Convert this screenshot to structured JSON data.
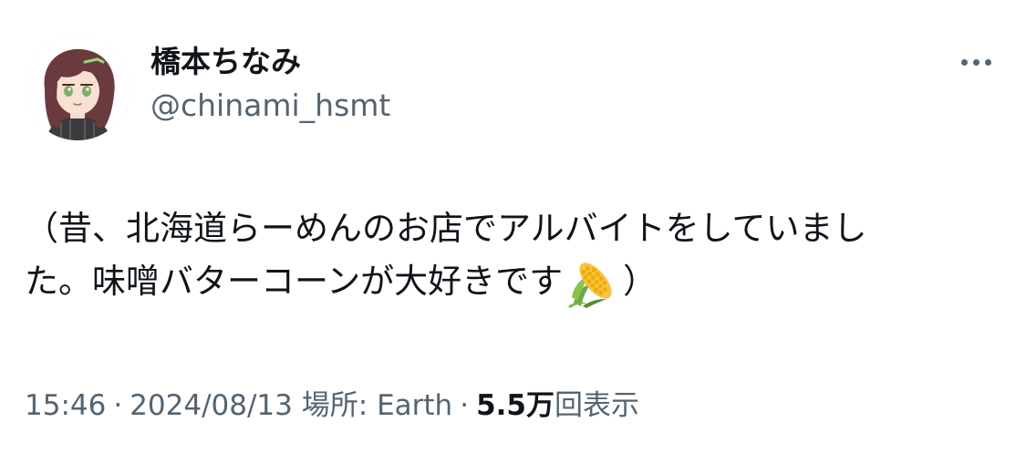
{
  "user": {
    "display_name": "橋本ちなみ",
    "handle": "@chinami_hsmt"
  },
  "more_menu": {
    "icon": "more-horizontal-icon"
  },
  "tweet": {
    "line1": "（昔、北海道らーめんのお店でアルバイトをしていまし",
    "line2_before_emoji": "た。味噌バターコーンが大好きです",
    "emoji": "🌽",
    "line2_after_emoji": "）"
  },
  "meta": {
    "time": "15:46",
    "dot1": "·",
    "date": "2024/08/13",
    "place_label": "場所:",
    "place_value": "Earth",
    "dot2": "·",
    "views_count": "5.5万",
    "views_label": "回表示"
  },
  "colors": {
    "text_primary": "#0f1419",
    "text_secondary": "#536471"
  }
}
